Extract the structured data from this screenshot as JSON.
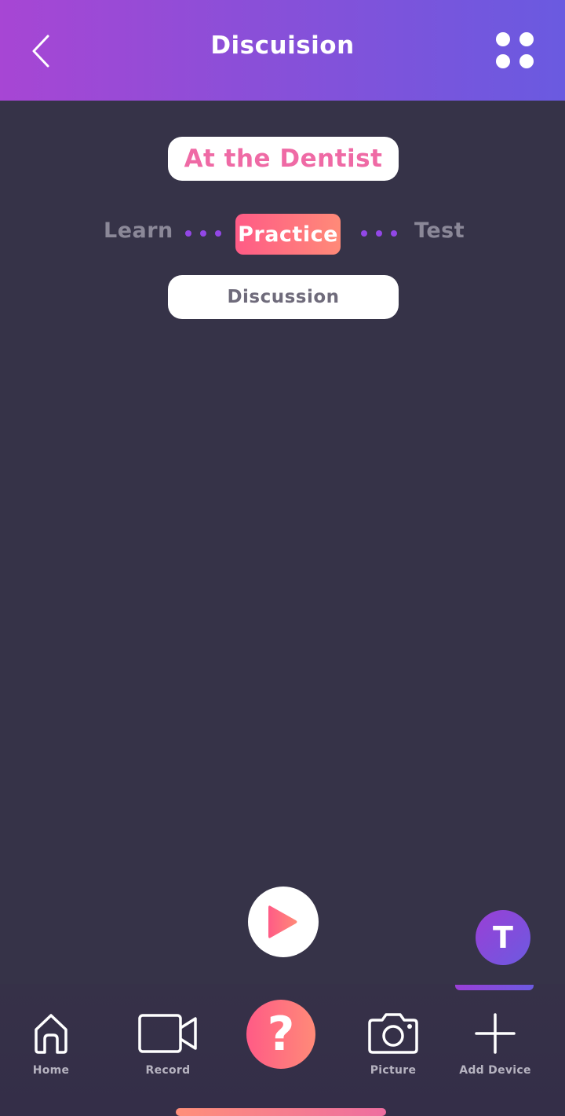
{
  "header": {
    "title": "Discuision",
    "back_icon": "chevron-left-icon",
    "menu_icon": "grid-dots-icon",
    "gradient": [
      "#a746d4",
      "#6a5ae0"
    ]
  },
  "topic": {
    "label": "At the Dentist",
    "color": "#ef6aa5"
  },
  "steps": {
    "items": [
      "Learn",
      "Practice",
      "Test"
    ],
    "active": "Practice",
    "dot_color": "#9247e6",
    "active_gradient": [
      "#ff5b86",
      "#ff8a78"
    ]
  },
  "discussion": {
    "label": "Discussion"
  },
  "player": {
    "play_icon": "play-icon"
  },
  "avatar": {
    "initial": "T"
  },
  "bottom_nav": {
    "items": [
      {
        "label": "Home",
        "icon": "home-icon"
      },
      {
        "label": "Record",
        "icon": "video-camera-icon"
      },
      {
        "label": "",
        "icon": "question-mark-icon",
        "glyph": "?"
      },
      {
        "label": "Picture",
        "icon": "camera-icon"
      },
      {
        "label": "Add Device",
        "icon": "plus-icon"
      }
    ]
  },
  "colors": {
    "background": "#363348",
    "accent_pink": "#ff5b86",
    "accent_purple": "#9247e6"
  }
}
